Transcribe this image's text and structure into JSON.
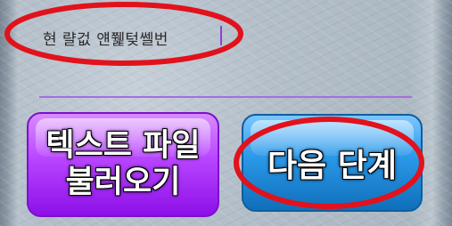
{
  "text_field": {
    "value": "현 랼겂 얜쮍텆쎌번"
  },
  "buttons": {
    "load_text_file_line1": "텍스트 파일",
    "load_text_file_line2": "불러오기",
    "next_step": "다음 단계"
  },
  "colors": {
    "purple_button": "#b844ff",
    "blue_button": "#1f87d8",
    "divider": "#a66fe0",
    "annotation": "#e1121b"
  }
}
